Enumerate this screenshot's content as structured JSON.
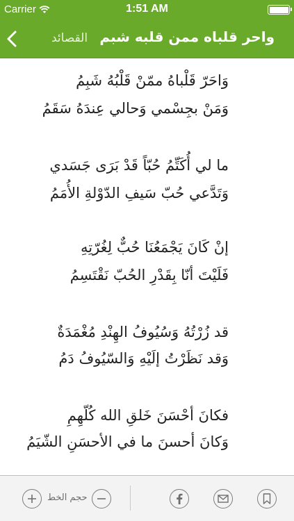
{
  "status_bar": {
    "carrier": "Carrier",
    "time": "1:51 AM"
  },
  "nav": {
    "back_label": "القصائد",
    "title": "واحر قلباه ممن قلبه شبم"
  },
  "poem": {
    "verses": [
      {
        "first": "وَاحَرّ قَلْباهُ ممّنْ قَلْبُهُ شَبِمُ",
        "second": "وَمَنْ بجِسْمي وَحالي عِندَهُ سَقَمُ"
      },
      {
        "first": "ما لي أُكَتِّمُ حُبّاً قَدْ بَرَى جَسَدي",
        "second": "وَتَدَّعي حُبّ سَيفِ الدّوْلةِ الأُمَمُ"
      },
      {
        "first": "إنْ كَانَ يَجْمَعُنَا حُبٌّ لِغُرّتِهِ",
        "second": "فَلَيْتَ أنّا بِقَدْرِ الحُبّ نَقْتَسِمُ"
      },
      {
        "first": "قد زُرْتُهُ وَسُيُوفُ الهِنْدِ مُغْمَدَةٌ",
        "second": "وَقد نَظَرْتُ إلَيْهِ وَالسّيُوفُ دَمُ"
      },
      {
        "first": "فكانَ أحْسَنَ خَلقِ الله كُلّهِمِ",
        "second": "وَكانَ أحسنَ ما في الأحسَنِ الشّيَمُ"
      }
    ]
  },
  "toolbar": {
    "font_size_label": "حجم الخط"
  },
  "colors": {
    "accent": "#6aaa2a",
    "toolbar_bg": "#f3f3f3",
    "icon_gray": "#6d6d6d"
  },
  "icons": [
    "wifi-icon",
    "battery-icon",
    "back-chevron-icon",
    "plus-icon",
    "minus-icon",
    "facebook-icon",
    "mail-icon",
    "bookmark-icon"
  ]
}
